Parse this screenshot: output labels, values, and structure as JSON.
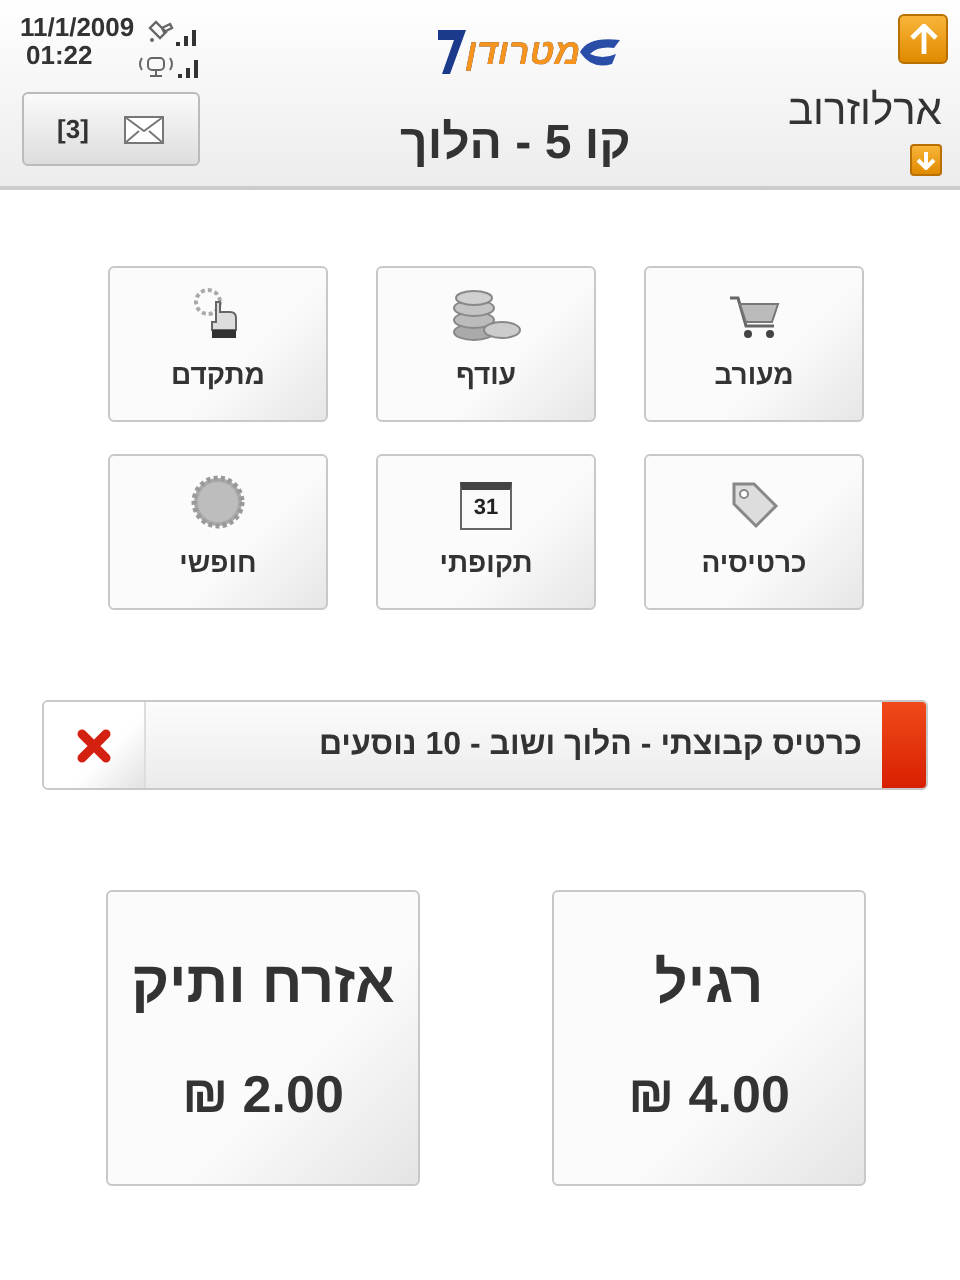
{
  "status": {
    "date": "11/1/2009",
    "time": "01:22"
  },
  "mail": {
    "count": "[3]"
  },
  "logo": "מטרודן",
  "title": "קו 5 - הלוך",
  "station": "ארלוזרוב",
  "ticket_types": [
    {
      "label": "מעורב"
    },
    {
      "label": "עודף"
    },
    {
      "label": "מתקדם"
    },
    {
      "label": "כרטיסיה"
    },
    {
      "label": "תקופתי"
    },
    {
      "label": "חופשי"
    }
  ],
  "calendar_day": "31",
  "selection": {
    "text": "כרטיס קבוצתי - הלוך ושוב - 10 נוסעים"
  },
  "fares": [
    {
      "name": "רגיל",
      "price": "4.00 ₪"
    },
    {
      "name": "אזרח ותיק",
      "price": "2.00 ₪"
    }
  ]
}
